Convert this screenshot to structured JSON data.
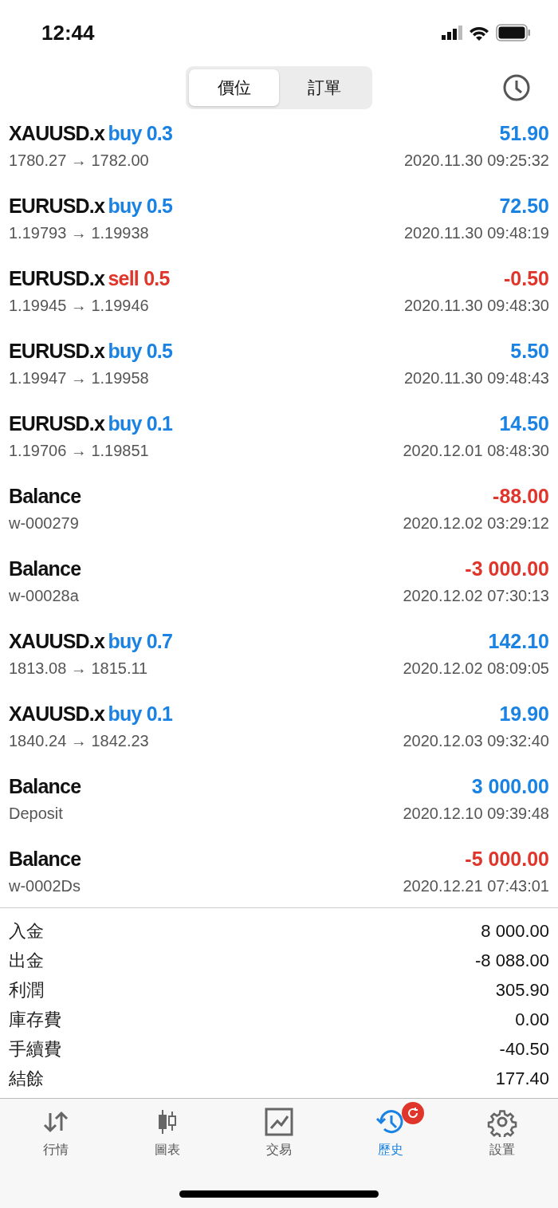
{
  "status_bar": {
    "time": "12:44"
  },
  "segments": [
    {
      "label": "價位",
      "selected": true
    },
    {
      "label": "訂單",
      "selected": false
    }
  ],
  "deals": [
    {
      "kind": "trade",
      "symbol": "XAUUSD.x",
      "side": "buy",
      "is_sell": false,
      "volume": "0.3",
      "detail": "1780.27 → 1782.00",
      "profit": "51.90",
      "loss": false,
      "time": "2020.11.30 09:25:32"
    },
    {
      "kind": "trade",
      "symbol": "EURUSD.x",
      "side": "buy",
      "is_sell": false,
      "volume": "0.5",
      "detail": "1.19793 → 1.19938",
      "profit": "72.50",
      "loss": false,
      "time": "2020.11.30 09:48:19"
    },
    {
      "kind": "trade",
      "symbol": "EURUSD.x",
      "side": "sell",
      "is_sell": true,
      "volume": "0.5",
      "detail": "1.19945 → 1.19946",
      "profit": "-0.50",
      "loss": true,
      "time": "2020.11.30 09:48:30"
    },
    {
      "kind": "trade",
      "symbol": "EURUSD.x",
      "side": "buy",
      "is_sell": false,
      "volume": "0.5",
      "detail": "1.19947 → 1.19958",
      "profit": "5.50",
      "loss": false,
      "time": "2020.11.30 09:48:43"
    },
    {
      "kind": "trade",
      "symbol": "EURUSD.x",
      "side": "buy",
      "is_sell": false,
      "volume": "0.1",
      "detail": "1.19706 → 1.19851",
      "profit": "14.50",
      "loss": false,
      "time": "2020.12.01 08:48:30"
    },
    {
      "kind": "balance",
      "symbol": "Balance",
      "detail": "w-000279",
      "profit": "-88.00",
      "loss": true,
      "time": "2020.12.02 03:29:12"
    },
    {
      "kind": "balance",
      "symbol": "Balance",
      "detail": "w-00028a",
      "profit": "-3 000.00",
      "loss": true,
      "time": "2020.12.02 07:30:13"
    },
    {
      "kind": "trade",
      "symbol": "XAUUSD.x",
      "side": "buy",
      "is_sell": false,
      "volume": "0.7",
      "detail": "1813.08 → 1815.11",
      "profit": "142.10",
      "loss": false,
      "time": "2020.12.02 08:09:05"
    },
    {
      "kind": "trade",
      "symbol": "XAUUSD.x",
      "side": "buy",
      "is_sell": false,
      "volume": "0.1",
      "detail": "1840.24 → 1842.23",
      "profit": "19.90",
      "loss": false,
      "time": "2020.12.03 09:32:40"
    },
    {
      "kind": "balance",
      "symbol": "Balance",
      "detail": "Deposit",
      "profit": "3 000.00",
      "loss": false,
      "time": "2020.12.10 09:39:48"
    },
    {
      "kind": "balance",
      "symbol": "Balance",
      "detail": "w-0002Ds",
      "profit": "-5 000.00",
      "loss": true,
      "time": "2020.12.21 07:43:01"
    }
  ],
  "summary": [
    {
      "label": "入金",
      "value": "8 000.00"
    },
    {
      "label": "出金",
      "value": "-8 088.00"
    },
    {
      "label": "利潤",
      "value": "305.90"
    },
    {
      "label": "庫存費",
      "value": "0.00"
    },
    {
      "label": "手續費",
      "value": "-40.50"
    },
    {
      "label": "結餘",
      "value": "177.40"
    }
  ],
  "tab_bar": [
    {
      "label": "行情",
      "selected": false,
      "badge": false
    },
    {
      "label": "圖表",
      "selected": false,
      "badge": false
    },
    {
      "label": "交易",
      "selected": false,
      "badge": false
    },
    {
      "label": "歷史",
      "selected": true,
      "badge": true
    },
    {
      "label": "設置",
      "selected": false,
      "badge": false
    }
  ]
}
